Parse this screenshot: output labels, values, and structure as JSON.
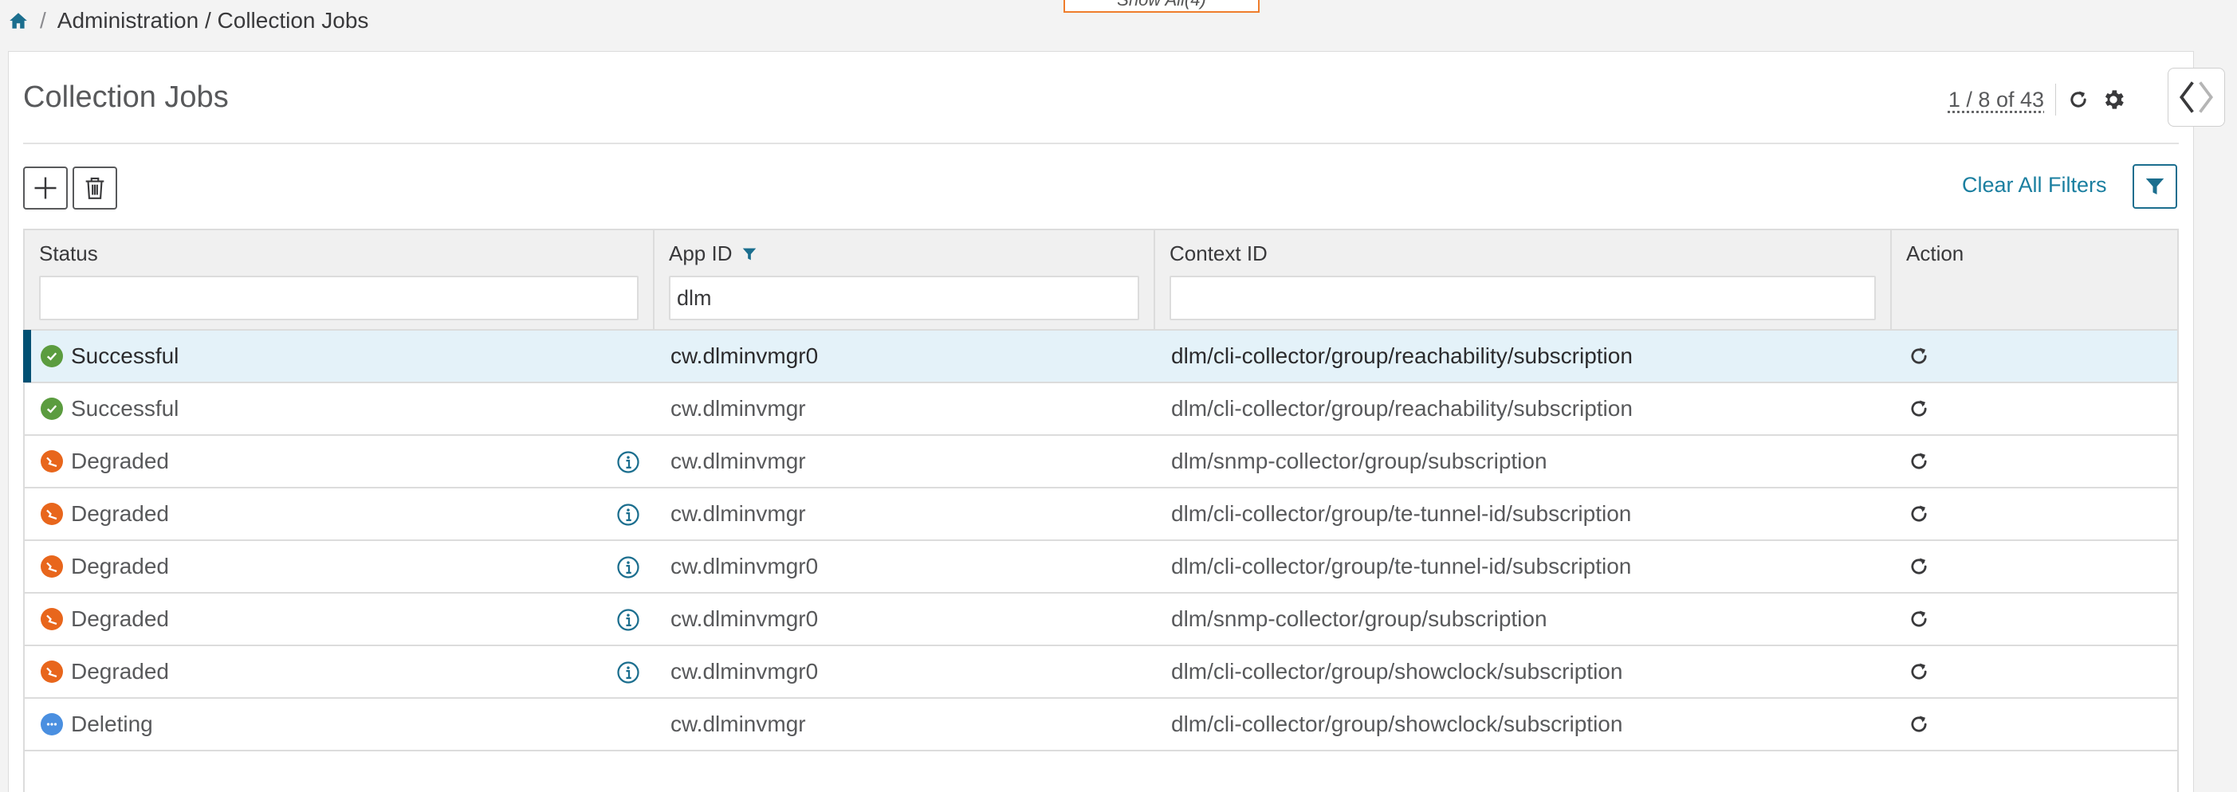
{
  "breadcrumb": {
    "home_icon": "home-icon",
    "separator": "/",
    "path": "Administration / Collection Jobs"
  },
  "show_all_label": "Show All(4)",
  "page": {
    "title": "Collection Jobs",
    "pager": "1 / 8 of 43",
    "refresh_icon": "refresh-icon",
    "settings_icon": "gear-icon",
    "side_toggle_icon": "chevron-left-right-icon"
  },
  "toolbar": {
    "add_icon": "plus-icon",
    "delete_icon": "trash-icon",
    "clear_filters_label": "Clear All Filters",
    "filter_icon": "filter-icon"
  },
  "table": {
    "columns": {
      "status": "Status",
      "app_id": "App ID",
      "context_id": "Context ID",
      "action": "Action"
    },
    "filters": {
      "status": "",
      "app_id": "dlm",
      "context_id": ""
    },
    "rows": [
      {
        "status": "Successful",
        "app_id": "cw.dlminvmgr0",
        "context_id": "dlm/cli-collector/group/reachability/subscription"
      },
      {
        "status": "Successful",
        "app_id": "cw.dlminvmgr",
        "context_id": "dlm/cli-collector/group/reachability/subscription"
      },
      {
        "status": "Degraded",
        "app_id": "cw.dlminvmgr",
        "context_id": "dlm/snmp-collector/group/subscription"
      },
      {
        "status": "Degraded",
        "app_id": "cw.dlminvmgr",
        "context_id": "dlm/cli-collector/group/te-tunnel-id/subscription"
      },
      {
        "status": "Degraded",
        "app_id": "cw.dlminvmgr0",
        "context_id": "dlm/cli-collector/group/te-tunnel-id/subscription"
      },
      {
        "status": "Degraded",
        "app_id": "cw.dlminvmgr0",
        "context_id": "dlm/snmp-collector/group/subscription"
      },
      {
        "status": "Degraded",
        "app_id": "cw.dlminvmgr0",
        "context_id": "dlm/cli-collector/group/showclock/subscription"
      },
      {
        "status": "Deleting",
        "app_id": "cw.dlminvmgr",
        "context_id": "dlm/cli-collector/group/showclock/subscription"
      }
    ]
  },
  "colors": {
    "accent": "#1b7fa0",
    "selected_row": "#e4f2f9",
    "selected_bar": "#005073",
    "success": "#5b9c3f",
    "degraded": "#e8661c",
    "deleting": "#4a8fe0"
  }
}
